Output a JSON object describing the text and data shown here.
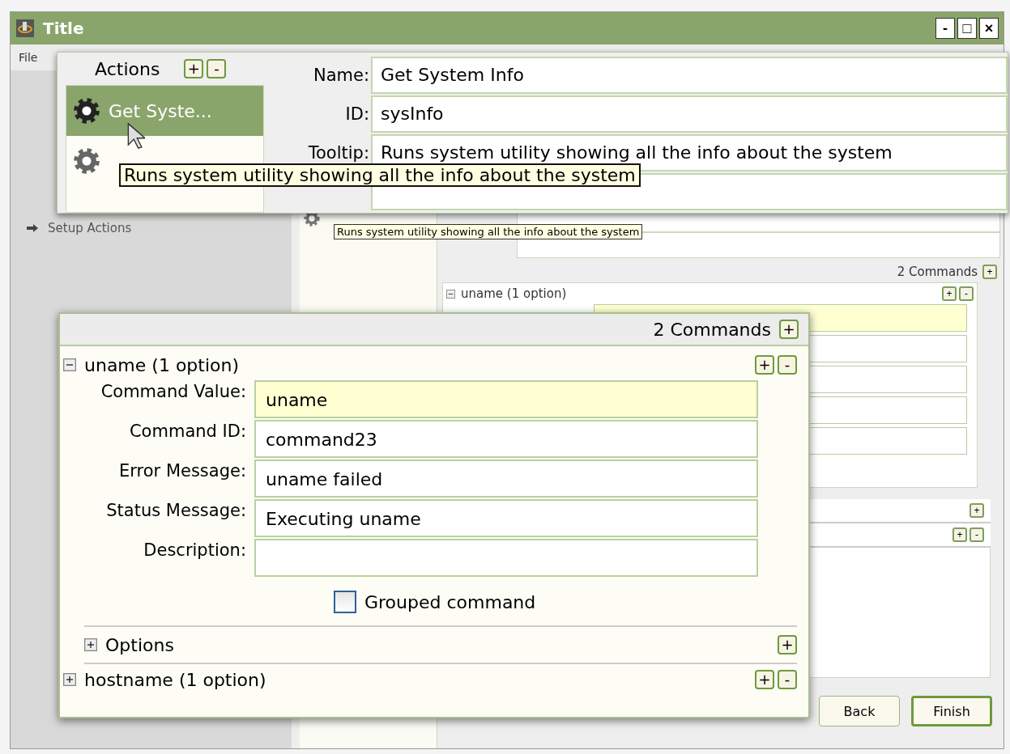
{
  "window": {
    "title": "Title",
    "controls": [
      "-",
      "□",
      "×"
    ]
  },
  "menu": [
    "File"
  ],
  "sidebar": {
    "items": [
      {
        "label": "Setup Actions"
      }
    ]
  },
  "background": {
    "tooltip": "Runs system utility showing all the info about the system",
    "commands_count": "2 Commands",
    "add_button": "+",
    "command": {
      "label": "uname (1 option)",
      "expanded": true,
      "buttons": [
        "+",
        "-"
      ],
      "fields": [
        {
          "focused": true
        },
        {
          "focused": false
        },
        {
          "focused": false
        },
        {
          "focused": false
        },
        {
          "focused": false
        }
      ]
    },
    "rows": [
      {
        "buttons": [
          "+"
        ]
      },
      {
        "buttons": [
          "+",
          "-"
        ]
      }
    ],
    "nav_buttons": [
      {
        "label": "Back",
        "default": false
      },
      {
        "label": "Finish",
        "default": true
      }
    ]
  },
  "actions_callout": {
    "heading": "Actions",
    "heading_buttons": [
      "+",
      "-"
    ],
    "items": [
      {
        "label": "Get Syste...",
        "selected": true
      },
      {
        "selected": false
      }
    ],
    "fields": [
      {
        "label": "Name:",
        "value": "Get System Info"
      },
      {
        "label": "ID:",
        "value": "sysInfo"
      },
      {
        "label": "Tooltip:",
        "value": "Runs system utility showing all the info about the system"
      }
    ],
    "tooltip": "Runs system utility showing all the info about the system"
  },
  "commands_callout": {
    "count": "2 Commands",
    "add_button": "+",
    "commands": [
      {
        "label": "uname (1 option)",
        "expanded": true,
        "buttons": [
          "+",
          "-"
        ],
        "fields": [
          {
            "label": "Command Value:",
            "value": "uname",
            "focused": true
          },
          {
            "label": "Command ID:",
            "value": "command23",
            "focused": false
          },
          {
            "label": "Error Message:",
            "value": "uname failed",
            "focused": false
          },
          {
            "label": "Status Message:",
            "value": "Executing uname",
            "focused": false
          },
          {
            "label": "Description:",
            "focused": false
          }
        ],
        "grouped": {
          "label": "Grouped command",
          "checked": false
        },
        "options": {
          "label": "Options",
          "expanded": false,
          "buttons": [
            "+"
          ]
        }
      },
      {
        "label": "hostname (1 option)",
        "expanded": false,
        "buttons": [
          "+",
          "-"
        ]
      }
    ]
  }
}
